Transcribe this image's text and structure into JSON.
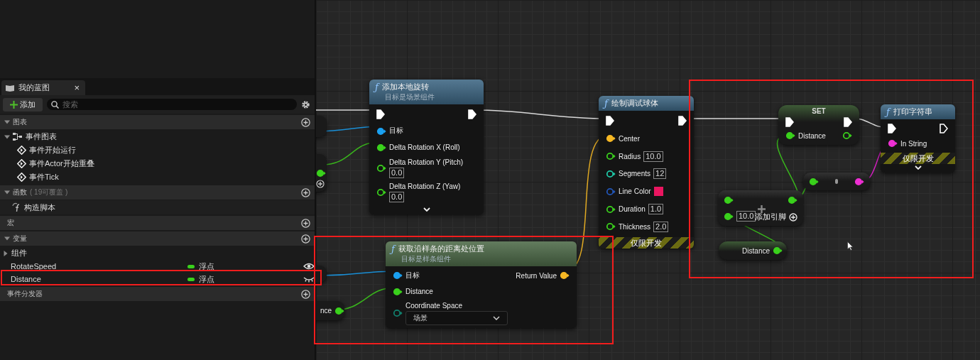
{
  "panel": {
    "tab": {
      "title": "我的蓝图",
      "close_glyph": "×"
    },
    "add_button": {
      "label": "添加"
    },
    "search": {
      "placeholder": "搜索"
    },
    "sections": [
      {
        "title": "图表",
        "expanded": true,
        "items": [
          {
            "kind": "graph",
            "label": "事件图表",
            "expanded": true,
            "children": [
              {
                "kind": "event",
                "label": "事件开始运行"
              },
              {
                "kind": "event",
                "label": "事件Actor开始重叠"
              },
              {
                "kind": "event",
                "label": "事件Tick"
              }
            ]
          }
        ]
      },
      {
        "title": "函数",
        "note": "( 19可覆盖 )",
        "expanded": true,
        "items": [
          {
            "kind": "function",
            "label": "构造脚本"
          }
        ]
      },
      {
        "title": "宏"
      },
      {
        "title": "变量",
        "expanded": true,
        "items": [
          {
            "kind": "category",
            "label": "组件",
            "expanded": false
          },
          {
            "kind": "variable",
            "label": "RotateSpeed",
            "type": "浮点",
            "public": true
          },
          {
            "kind": "variable",
            "label": "Distance",
            "type": "浮点",
            "public": false
          }
        ]
      },
      {
        "title": "事件分发器"
      }
    ]
  },
  "graph": {
    "nodes": [
      {
        "kind": "stub"
      },
      {
        "kind": "stub",
        "rows": [
          {
            "right": {
              "kind": "float",
              "connected": true
            }
          }
        ],
        "add_pin": true
      },
      {
        "kind": "function",
        "icon_glyph": "ƒ",
        "title": "添加本地旋转",
        "subtitle": "目标是场景组件",
        "color": "#3d6683",
        "stacked_values": true,
        "expandable": true,
        "rows": [
          {
            "left": {
              "kind": "exec",
              "connected": true
            },
            "right": {
              "kind": "exec",
              "connected": true
            }
          },
          {
            "left": {
              "kind": "object",
              "label": "目标",
              "connected": true
            }
          },
          {
            "left": {
              "kind": "float",
              "label": "Delta Rotation X (Roll)",
              "connected": true
            }
          },
          {
            "left": {
              "kind": "float",
              "label": "Delta Rotation Y (Pitch)",
              "connected": false,
              "value": "0.0"
            }
          },
          {
            "left": {
              "kind": "float",
              "label": "Delta Rotation Z (Yaw)",
              "connected": false,
              "value": "0.0"
            }
          }
        ]
      },
      {
        "kind": "function",
        "icon_glyph": "ƒ",
        "title": "绘制调试球体",
        "color": "#3d6683",
        "footer": "仅限开发",
        "rows": [
          {
            "left": {
              "kind": "exec",
              "connected": true
            },
            "right": {
              "kind": "exec",
              "connected": true
            }
          },
          {
            "left": {
              "kind": "vector",
              "label": "Center",
              "connected": true
            }
          },
          {
            "left": {
              "kind": "float",
              "label": "Radius",
              "connected": false,
              "value": "10.0"
            }
          },
          {
            "left": {
              "kind": "int",
              "label": "Segments",
              "connected": false,
              "value": "12"
            }
          },
          {
            "left": {
              "kind": "struct",
              "label": "Line Color",
              "connected": false,
              "color": "#ea1660"
            }
          },
          {
            "left": {
              "kind": "float",
              "label": "Duration",
              "connected": false,
              "value": "1.0"
            }
          },
          {
            "left": {
              "kind": "float",
              "label": "Thickness",
              "connected": false,
              "value": "2.0"
            }
          }
        ]
      },
      {
        "kind": "set",
        "title": "SET",
        "rows": [
          {
            "left": {
              "kind": "exec",
              "connected": true
            },
            "right": {
              "kind": "exec",
              "connected": true
            }
          },
          {
            "left": {
              "kind": "float",
              "label": "Distance",
              "connected": true
            },
            "right": {
              "kind": "float",
              "connected": false
            }
          }
        ]
      },
      {
        "kind": "function",
        "icon_glyph": "ƒ",
        "title": "打印字符串",
        "color": "#3d6683",
        "footer": "仅限开发",
        "expandable": true,
        "rows": [
          {
            "left": {
              "kind": "exec",
              "connected": true
            },
            "right": {
              "kind": "exec",
              "connected": false
            }
          },
          {
            "left": {
              "kind": "string",
              "label": "In String",
              "connected": true
            }
          }
        ]
      },
      {
        "kind": "convert",
        "rows": [
          {
            "left": {
              "kind": "float",
              "connected": true
            },
            "right": {
              "kind": "string",
              "connected": true
            }
          }
        ]
      },
      {
        "kind": "operator",
        "add_pin_label": "添加引脚",
        "rows": [
          {
            "left": {
              "kind": "float",
              "connected": true
            },
            "right": {
              "kind": "float",
              "connected": true
            }
          },
          {
            "left": {
              "kind": "float",
              "connected": true,
              "value": "10.0"
            }
          }
        ]
      },
      {
        "kind": "stub"
      },
      {
        "kind": "stub",
        "rows": [
          {
            "right": {
              "kind": "float",
              "label": "nce",
              "connected": true
            }
          }
        ]
      },
      {
        "kind": "function",
        "icon_glyph": "ƒ",
        "title": "获取沿样条的距离处位置",
        "subtitle": "目标是样条组件",
        "color": "#4d6a48",
        "rows": [
          {
            "left": {
              "kind": "object",
              "label": "目标",
              "connected": true
            },
            "right": {
              "kind": "vector",
              "label": "Return Value",
              "connected": true
            }
          },
          {
            "left": {
              "kind": "float",
              "label": "Distance",
              "connected": true
            }
          },
          {
            "left": {
              "kind": "enum",
              "label": "Coordinate Space",
              "connected": false,
              "value": "场景"
            }
          }
        ]
      },
      {
        "kind": "getter",
        "rows": [
          {
            "right": {
              "kind": "float",
              "label": "Distance",
              "connected": true
            }
          }
        ]
      }
    ]
  }
}
